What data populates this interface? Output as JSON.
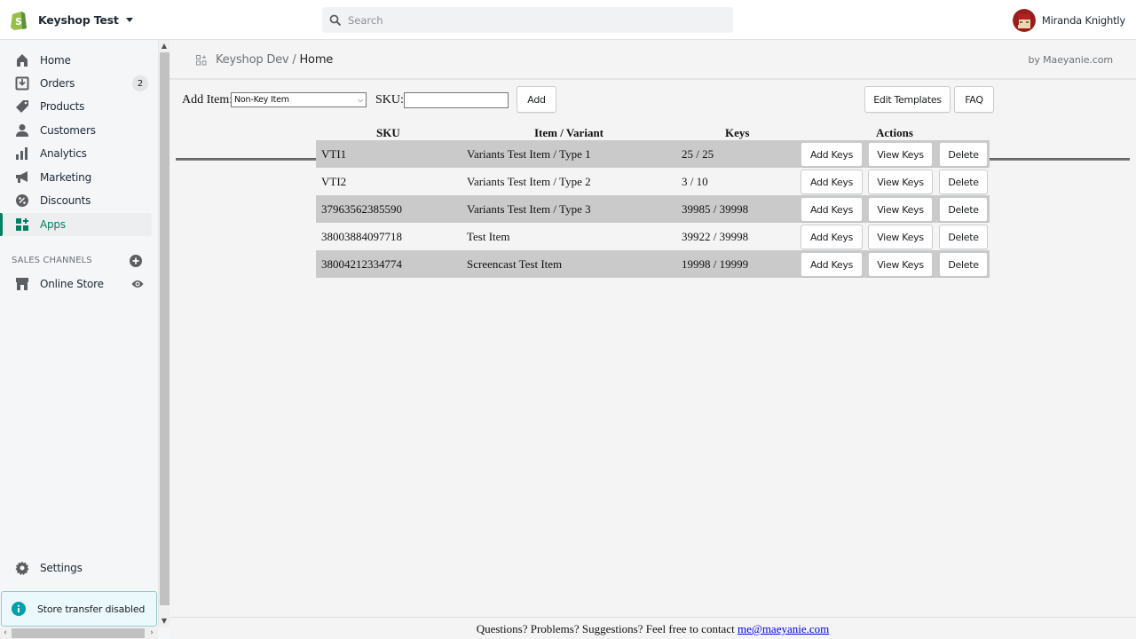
{
  "topbar": {
    "store_name": "Keyshop Test",
    "search_placeholder": "Search",
    "user_name": "Miranda Knightly"
  },
  "sidebar": {
    "items": [
      {
        "label": "Home",
        "icon": "home-icon"
      },
      {
        "label": "Orders",
        "icon": "orders-icon",
        "badge": "2"
      },
      {
        "label": "Products",
        "icon": "tag-icon"
      },
      {
        "label": "Customers",
        "icon": "person-icon"
      },
      {
        "label": "Analytics",
        "icon": "bar-chart-icon"
      },
      {
        "label": "Marketing",
        "icon": "megaphone-icon"
      },
      {
        "label": "Discounts",
        "icon": "discount-icon"
      },
      {
        "label": "Apps",
        "icon": "apps-icon",
        "active": true
      }
    ],
    "sales_channels_title": "SALES CHANNELS",
    "online_store": "Online Store",
    "settings": "Settings",
    "store_transfer": "Store transfer disabled"
  },
  "app": {
    "breadcrumb_parent": "Keyshop Dev",
    "breadcrumb_sep": "/",
    "breadcrumb_current": "Home",
    "byline": "by Maeyanie.com",
    "toolbar": {
      "add_item_label": "Add Item:",
      "item_type_selected": "Non-Key Item",
      "sku_label": "SKU:",
      "sku_value": "",
      "add_button": "Add",
      "edit_templates_button": "Edit Templates",
      "faq_button": "FAQ"
    },
    "table": {
      "headers": {
        "sku": "SKU",
        "item": "Item / Variant",
        "keys": "Keys",
        "actions": "Actions"
      },
      "action_labels": {
        "add_keys": "Add Keys",
        "view_keys": "View Keys",
        "delete": "Delete"
      },
      "rows": [
        {
          "sku": "VTI1",
          "item": "Variants Test Item / Type 1",
          "keys": "25 / 25"
        },
        {
          "sku": "VTI2",
          "item": "Variants Test Item / Type 2",
          "keys": "3 / 10"
        },
        {
          "sku": "37963562385590",
          "item": "Variants Test Item / Type 3",
          "keys": "39985 / 39998"
        },
        {
          "sku": "38003884097718",
          "item": "Test Item",
          "keys": "39922 / 39998"
        },
        {
          "sku": "38004212334774",
          "item": "Screencast Test Item",
          "keys": "19998 / 19999"
        }
      ]
    },
    "footer": {
      "text": "Questions? Problems? Suggestions? Feel free to contact ",
      "email": "me@maeyanie.com"
    }
  },
  "colors": {
    "accent": "#008060",
    "row_shade": "#cacaca",
    "link": "#0000ee"
  }
}
